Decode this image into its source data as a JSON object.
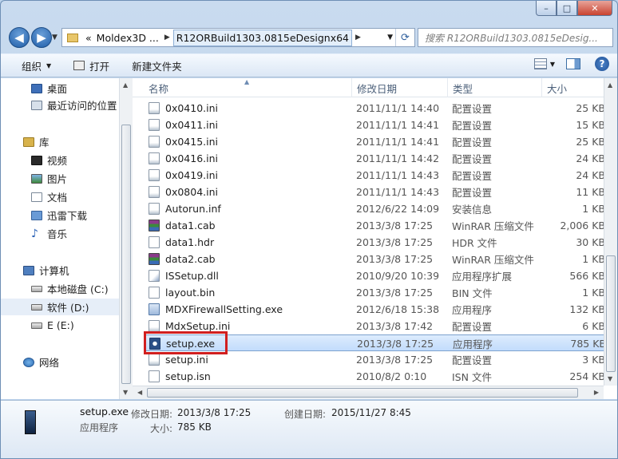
{
  "window": {
    "minimize": "–",
    "maximize": "□",
    "close": "✕"
  },
  "address": {
    "crumbs": [
      "Moldex3D ...",
      "R12ORBuild1303.0815eDesignx64"
    ],
    "prefix": "«",
    "search_placeholder": "搜索 R12ORBuild1303.0815eDesig..."
  },
  "toolbar": {
    "organize": "组织",
    "open": "打开",
    "new_folder": "新建文件夹"
  },
  "nav": {
    "items": [
      {
        "label": "桌面",
        "icon": "desktop-icon"
      },
      {
        "label": "最近访问的位置",
        "icon": "recent-places-icon"
      },
      {
        "label": "库",
        "icon": "library-icon"
      },
      {
        "label": "视频",
        "icon": "video-icon"
      },
      {
        "label": "图片",
        "icon": "pictures-icon"
      },
      {
        "label": "文档",
        "icon": "documents-icon"
      },
      {
        "label": "迅雷下载",
        "icon": "download-icon"
      },
      {
        "label": "音乐",
        "icon": "music-icon"
      },
      {
        "label": "计算机",
        "icon": "computer-icon"
      },
      {
        "label": "本地磁盘 (C:)",
        "icon": "drive-icon"
      },
      {
        "label": "软件 (D:)",
        "icon": "drive-icon"
      },
      {
        "label": "E (E:)",
        "icon": "drive-icon"
      },
      {
        "label": "网络",
        "icon": "network-icon"
      }
    ]
  },
  "columns": {
    "name": "名称",
    "date": "修改日期",
    "type": "类型",
    "size": "大小"
  },
  "files": [
    {
      "name": "0x0410.ini",
      "date": "2011/11/1 14:40",
      "type": "配置设置",
      "size": "25 KB"
    },
    {
      "name": "0x0411.ini",
      "date": "2011/11/1 14:41",
      "type": "配置设置",
      "size": "15 KB"
    },
    {
      "name": "0x0415.ini",
      "date": "2011/11/1 14:41",
      "type": "配置设置",
      "size": "25 KB"
    },
    {
      "name": "0x0416.ini",
      "date": "2011/11/1 14:42",
      "type": "配置设置",
      "size": "24 KB"
    },
    {
      "name": "0x0419.ini",
      "date": "2011/11/1 14:43",
      "type": "配置设置",
      "size": "24 KB"
    },
    {
      "name": "0x0804.ini",
      "date": "2011/11/1 14:43",
      "type": "配置设置",
      "size": "11 KB"
    },
    {
      "name": "Autorun.inf",
      "date": "2012/6/22 14:09",
      "type": "安装信息",
      "size": "1 KB"
    },
    {
      "name": "data1.cab",
      "date": "2013/3/8 17:25",
      "type": "WinRAR 压缩文件",
      "size": "2,006 KB"
    },
    {
      "name": "data1.hdr",
      "date": "2013/3/8 17:25",
      "type": "HDR 文件",
      "size": "30 KB"
    },
    {
      "name": "data2.cab",
      "date": "2013/3/8 17:25",
      "type": "WinRAR 压缩文件",
      "size": "1 KB"
    },
    {
      "name": "ISSetup.dll",
      "date": "2010/9/20 10:39",
      "type": "应用程序扩展",
      "size": "566 KB"
    },
    {
      "name": "layout.bin",
      "date": "2013/3/8 17:25",
      "type": "BIN 文件",
      "size": "1 KB"
    },
    {
      "name": "MDXFirewallSetting.exe",
      "date": "2012/6/18 15:38",
      "type": "应用程序",
      "size": "132 KB"
    },
    {
      "name": "MdxSetup.ini",
      "date": "2013/3/8 17:42",
      "type": "配置设置",
      "size": "6 KB"
    },
    {
      "name": "setup.exe",
      "date": "2013/3/8 17:25",
      "type": "应用程序",
      "size": "785 KB"
    },
    {
      "name": "setup.ini",
      "date": "2013/3/8 17:25",
      "type": "配置设置",
      "size": "3 KB"
    },
    {
      "name": "setup.isn",
      "date": "2010/8/2 0:10",
      "type": "ISN 文件",
      "size": "254 KB"
    }
  ],
  "details": {
    "name": "setup.exe",
    "type": "应用程序",
    "modified_label": "修改日期:",
    "modified_value": "2013/3/8 17:25",
    "created_label": "创建日期:",
    "created_value": "2015/11/27 8:45",
    "size_label": "大小:",
    "size_value": "785 KB"
  }
}
